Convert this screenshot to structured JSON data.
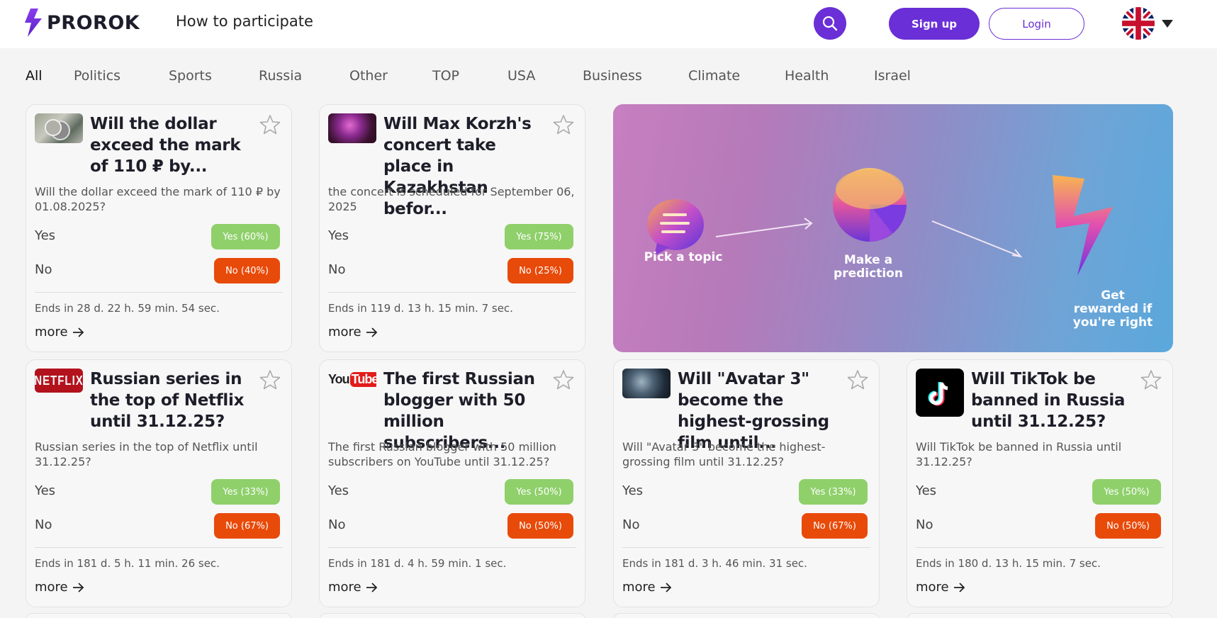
{
  "brand": {
    "name": "PROROK",
    "accent": "#6a2fd6"
  },
  "nav": {
    "how_to": "How to participate"
  },
  "auth": {
    "signup": "Sign up",
    "login": "Login"
  },
  "categories": [
    "All",
    "Politics",
    "Sports",
    "Russia",
    "Other",
    "TOP",
    "USA",
    "Business",
    "Climate",
    "Health",
    "Israel"
  ],
  "active_category": "All",
  "banner": {
    "step1": "Pick a topic",
    "step2": "Make a prediction",
    "step3": "Get rewarded if you're right"
  },
  "option_labels": {
    "yes": "Yes",
    "no": "No"
  },
  "more_label": "more",
  "cards": [
    {
      "title": "Will the dollar exceed the mark of 110 ₽ by...",
      "desc": "Will the dollar exceed the mark of 110 ₽ by 01.08.2025?",
      "yes": "Yes (60%)",
      "no": "No (40%)",
      "ends": "Ends in 28 d. 22 h. 59 min. 54 sec.",
      "thumb": "dollar-coins-icon"
    },
    {
      "title": "Will Max Korzh's concert take place in Kazakhstan befor...",
      "desc": "the concert is scheduled for September 06, 2025",
      "yes": "Yes (75%)",
      "no": "No (25%)",
      "ends": "Ends in 119 d. 13 h. 15 min. 7 sec.",
      "thumb": "concert-photo-icon"
    },
    {
      "title": "Russian series in the top of Netflix until 31.12.25?",
      "desc": "Russian series in the top of Netflix until 31.12.25?",
      "yes": "Yes (33%)",
      "no": "No (67%)",
      "ends": "Ends in 181 d. 5 h. 11 min. 26 sec.",
      "thumb": "netflix-logo",
      "thumb_text": "NETFLIX"
    },
    {
      "title": "The first Russian blogger with 50 million subscribers...",
      "desc": "The first Russian blogger with 50 million subscribers on YouTube until 31.12.25?",
      "yes": "Yes (50%)",
      "no": "No (50%)",
      "ends": "Ends in 181 d. 4 h. 59 min. 1 sec.",
      "thumb": "youtube-logo",
      "thumb_text_a": "You",
      "thumb_text_b": "Tube"
    },
    {
      "title": "Will \"Avatar 3\" become the highest-grossing film until...",
      "desc": "Will \"Avatar 3\" become the highest-grossing film until 31.12.25?",
      "yes": "Yes (33%)",
      "no": "No (67%)",
      "ends": "Ends in 181 d. 3 h. 46 min. 31 sec.",
      "thumb": "avatar-photo-icon"
    },
    {
      "title": "Will TikTok be banned in Russia until 31.12.25?",
      "desc": "Will TikTok be banned in Russia until 31.12.25?",
      "yes": "Yes (50%)",
      "no": "No (50%)",
      "ends": "Ends in 180 d. 13 h. 15 min. 7 sec.",
      "thumb": "tiktok-logo"
    }
  ]
}
